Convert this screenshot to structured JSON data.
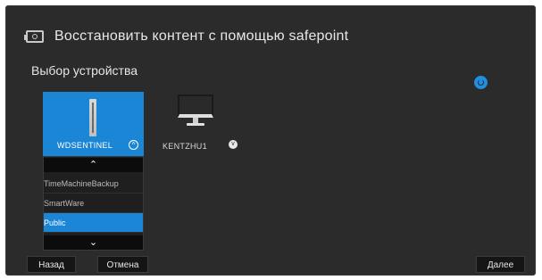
{
  "header": {
    "title": "Восстановить контент с помощью safepoint",
    "icon": "drive-restore-icon"
  },
  "section": {
    "label": "Выбор устройства",
    "refresh_icon": "refresh-icon"
  },
  "devices": [
    {
      "name": "WDSENTINEL",
      "icon": "tower-server-icon",
      "selected": true,
      "expanded": true,
      "shares": [
        "TimeMachineBackup",
        "SmartWare",
        "Public"
      ],
      "selected_share": "Public"
    },
    {
      "name": "KENTZHU1",
      "icon": "monitor-icon",
      "selected": false,
      "expanded": false
    }
  ],
  "buttons": {
    "back": "Назад",
    "cancel": "Отмена",
    "next": "Далее"
  },
  "colors": {
    "accent": "#1b86d6",
    "background": "#2b2b2b"
  }
}
